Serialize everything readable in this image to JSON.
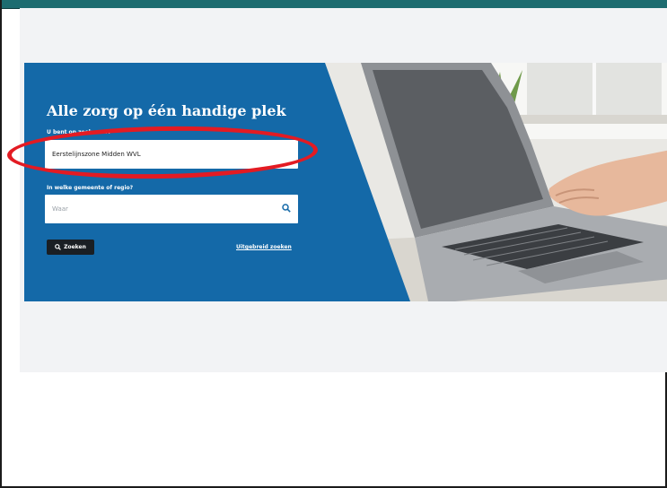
{
  "hero": {
    "title": "Alle zorg op één handige plek",
    "search_label": "U bent op zoek naar?",
    "search_value": "Eerstelijnszone Midden WVL",
    "location_label": "In welke gemeente of regio?",
    "location_placeholder": "Waar",
    "search_button": "Zoeken",
    "advanced_link": "Uitgebreid zoeken"
  },
  "icons": {
    "location_search": "search-icon",
    "button_search": "search-icon"
  },
  "colors": {
    "topbar": "#1d6c70",
    "hero_blue": "#1469a8",
    "button": "#1a1f24",
    "annotation": "#e31b23"
  }
}
